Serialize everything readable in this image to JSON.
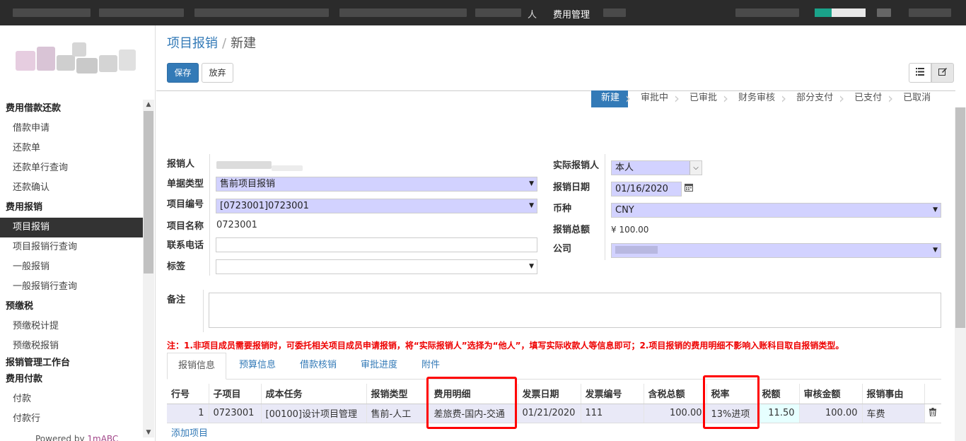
{
  "topbar": {
    "menu_left": "人",
    "menu_active": "费用管理"
  },
  "sidebar": {
    "items": [
      {
        "label": "费用借款还款",
        "type": "group"
      },
      {
        "label": "借款申请",
        "type": "item"
      },
      {
        "label": "还款单",
        "type": "item"
      },
      {
        "label": "还款单行查询",
        "type": "item"
      },
      {
        "label": "还款确认",
        "type": "item"
      },
      {
        "label": "费用报销",
        "type": "group"
      },
      {
        "label": "项目报销",
        "type": "item",
        "active": true
      },
      {
        "label": "项目报销行查询",
        "type": "item"
      },
      {
        "label": "一般报销",
        "type": "item"
      },
      {
        "label": "一般报销行查询",
        "type": "item"
      },
      {
        "label": "预缴税",
        "type": "group"
      },
      {
        "label": "预缴税计提",
        "type": "item"
      },
      {
        "label": "预缴税报销",
        "type": "item"
      },
      {
        "label": "报销管理工作台",
        "type": "group"
      },
      {
        "label": "费用付款",
        "type": "group"
      },
      {
        "label": "付款",
        "type": "item"
      },
      {
        "label": "付款行",
        "type": "item"
      }
    ],
    "powered_prefix": "Powered by ",
    "powered_brand": "1mABC"
  },
  "breadcrumb": {
    "parent": "项目报销",
    "separator": "/",
    "current": "新建"
  },
  "buttons": {
    "save": "保存",
    "discard": "放弃"
  },
  "view_switch": {
    "list_icon": "list-icon",
    "form_icon": "edit-icon"
  },
  "status": [
    "新建",
    "审批中",
    "已审批",
    "财务审核",
    "部分支付",
    "已支付",
    "已取消"
  ],
  "form": {
    "left": {
      "reporter_label": "报销人",
      "doc_type_label": "单据类型",
      "doc_type_value": "售前项目报销",
      "project_code_label": "项目编号",
      "project_code_value": "[0723001]0723001",
      "project_name_label": "项目名称",
      "project_name_value": "0723001",
      "phone_label": "联系电话",
      "phone_value": "",
      "tags_label": "标签",
      "tags_value": ""
    },
    "right": {
      "actual_reporter_label": "实际报销人",
      "actual_reporter_value": "本人",
      "date_label": "报销日期",
      "date_value": "01/16/2020",
      "currency_label": "币种",
      "currency_value": "CNY",
      "total_label": "报销总额",
      "total_value": "¥ 100.00",
      "company_label": "公司"
    },
    "remark_label": "备注",
    "remark_value": ""
  },
  "note": "注：1.非项目成员需要报销时，可委托相关项目成员申请报销，将“实际报销人”选择为“他人”，填写实际收款人等信息即可；2.项目报销的费用明细不影响入账科目取自报销类型。",
  "tabs": [
    "报销信息",
    "预算信息",
    "借款核销",
    "审批进度",
    "附件"
  ],
  "table": {
    "headers": [
      "行号",
      "子项目",
      "成本任务",
      "报销类型",
      "费用明细",
      "发票日期",
      "发票编号",
      "含税总额",
      "税率",
      "税额",
      "审核金额",
      "报销事由"
    ],
    "rows": [
      [
        "1",
        "0723001",
        "[00100]设计项目管理",
        "售前-人工",
        "差旅费-国内-交通",
        "01/21/2020",
        "111",
        "100.00",
        "13%进项",
        "11.50",
        "100.00",
        "车费"
      ]
    ],
    "add_line": "添加项目"
  }
}
